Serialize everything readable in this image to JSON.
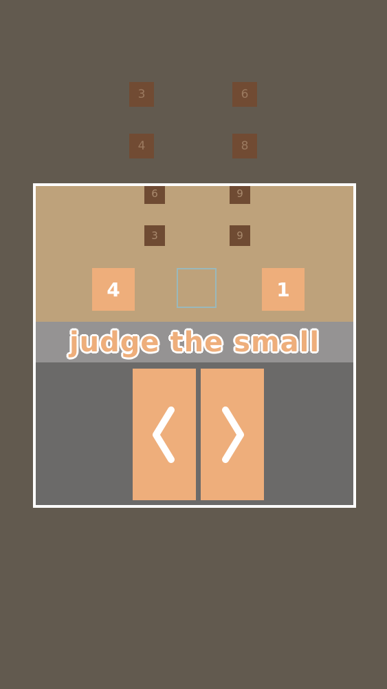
{
  "background_tiles": [
    {
      "value": "3"
    },
    {
      "value": "6"
    },
    {
      "value": "4"
    },
    {
      "value": "8"
    }
  ],
  "panel": {
    "faded_tiles": [
      {
        "value": "6"
      },
      {
        "value": "9"
      },
      {
        "value": "3"
      },
      {
        "value": "9"
      }
    ],
    "left_tile": "4",
    "right_tile": "1",
    "instruction": "judge the small"
  },
  "controls": {
    "left_icon": "chevron-left-icon",
    "right_icon": "chevron-right-icon"
  },
  "colors": {
    "background": "#625a4f",
    "panel_top": "#bea27b",
    "banner": "#959393",
    "panel_bottom": "#6b6a69",
    "accent": "#eeae7b",
    "slot_outline": "#9ab8bb"
  }
}
